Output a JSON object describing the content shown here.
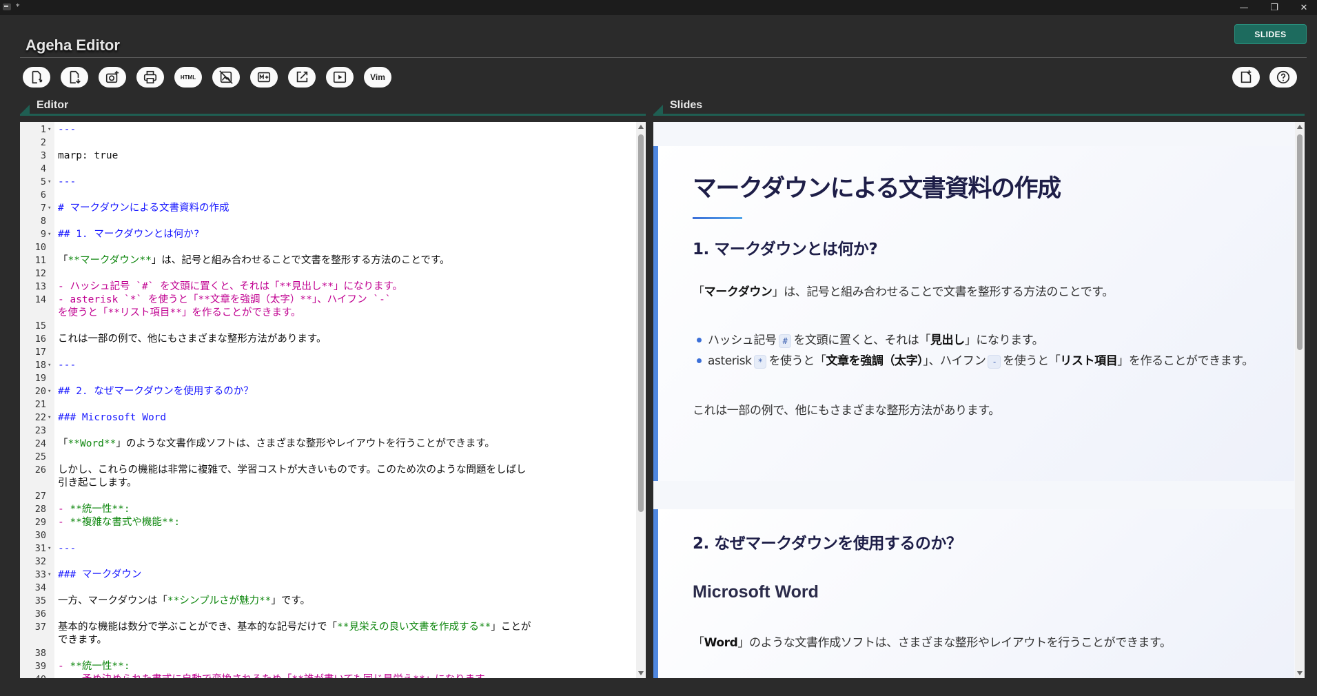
{
  "window": {
    "title_icon": "terminal-icon",
    "title_text": "*",
    "minimize": "—",
    "maximize": "❐",
    "close": "✕"
  },
  "header": {
    "app_title": "Ageha Editor",
    "mode_button": "SLIDES"
  },
  "toolbar": {
    "html_label": "HTML",
    "vim_label": "Vim",
    "left_icons": [
      "open-file-icon",
      "save-file-icon",
      "screenshot-icon",
      "print-icon",
      "html-export-icon",
      "hide-image-icon",
      "markdown-icon",
      "open-external-icon",
      "play-slideshow-icon",
      "vim-mode-icon"
    ],
    "right_icons": [
      "new-file-icon",
      "help-icon"
    ]
  },
  "panels": {
    "editor_label": "Editor",
    "slides_label": "Slides"
  },
  "editor": {
    "lines": [
      {
        "n": "1",
        "fold": true,
        "segs": [
          {
            "c": "blue",
            "t": "---"
          }
        ]
      },
      {
        "n": "2",
        "segs": []
      },
      {
        "n": "3",
        "segs": [
          {
            "c": "",
            "t": "marp: true"
          }
        ]
      },
      {
        "n": "4",
        "segs": []
      },
      {
        "n": "5",
        "fold": true,
        "segs": [
          {
            "c": "blue",
            "t": "---"
          }
        ]
      },
      {
        "n": "6",
        "segs": []
      },
      {
        "n": "7",
        "fold": true,
        "segs": [
          {
            "c": "blue",
            "t": "# マークダウンによる文書資料の作成"
          }
        ]
      },
      {
        "n": "8",
        "segs": []
      },
      {
        "n": "9",
        "fold": true,
        "segs": [
          {
            "c": "blue",
            "t": "## 1. マークダウンとは何か?"
          }
        ]
      },
      {
        "n": "10",
        "segs": []
      },
      {
        "n": "11",
        "segs": [
          {
            "c": "",
            "t": "「"
          },
          {
            "c": "green",
            "t": "**マークダウン**"
          },
          {
            "c": "",
            "t": "」は、記号と組み合わせることで文書を整形する方法のことです。"
          }
        ]
      },
      {
        "n": "12",
        "segs": []
      },
      {
        "n": "13",
        "segs": [
          {
            "c": "magenta",
            "t": "- ハッシュ記号 `#` を文頭に置くと、それは「**見出し**」になります。"
          }
        ]
      },
      {
        "n": "14",
        "segs": [
          {
            "c": "magenta",
            "t": "- asterisk `*` を使うと「**文章を強調（太字）**」、ハイフン `-`\nを使うと「**リスト項目**」を作ることができます。"
          }
        ]
      },
      {
        "n": "15",
        "segs": []
      },
      {
        "n": "16",
        "segs": [
          {
            "c": "",
            "t": "これは一部の例で、他にもさまざまな整形方法があります。"
          }
        ]
      },
      {
        "n": "17",
        "segs": []
      },
      {
        "n": "18",
        "fold": true,
        "segs": [
          {
            "c": "blue",
            "t": "---"
          }
        ]
      },
      {
        "n": "19",
        "segs": []
      },
      {
        "n": "20",
        "fold": true,
        "segs": [
          {
            "c": "blue",
            "t": "## 2. なぜマークダウンを使用するのか？"
          }
        ]
      },
      {
        "n": "21",
        "segs": []
      },
      {
        "n": "22",
        "fold": true,
        "segs": [
          {
            "c": "blue",
            "t": "### Microsoft Word"
          }
        ]
      },
      {
        "n": "23",
        "segs": []
      },
      {
        "n": "24",
        "segs": [
          {
            "c": "",
            "t": "「"
          },
          {
            "c": "green",
            "t": "**Word**"
          },
          {
            "c": "",
            "t": "」のような文書作成ソフトは、さまざまな整形やレイアウトを行うことができます。"
          }
        ]
      },
      {
        "n": "25",
        "segs": []
      },
      {
        "n": "26",
        "segs": [
          {
            "c": "",
            "t": "しかし、これらの機能は非常に複雑で、学習コストが大きいものです。このため次のような問題をしばし\n引き起こします。"
          }
        ]
      },
      {
        "n": "27",
        "segs": []
      },
      {
        "n": "28",
        "segs": [
          {
            "c": "magenta",
            "t": "- "
          },
          {
            "c": "green",
            "t": "**統一性**:"
          }
        ]
      },
      {
        "n": "29",
        "segs": [
          {
            "c": "magenta",
            "t": "- "
          },
          {
            "c": "green",
            "t": "**複雑な書式や機能**:"
          }
        ]
      },
      {
        "n": "30",
        "segs": []
      },
      {
        "n": "31",
        "fold": true,
        "segs": [
          {
            "c": "blue",
            "t": "---"
          }
        ]
      },
      {
        "n": "32",
        "segs": []
      },
      {
        "n": "33",
        "fold": true,
        "segs": [
          {
            "c": "blue",
            "t": "### マークダウン"
          }
        ]
      },
      {
        "n": "34",
        "segs": []
      },
      {
        "n": "35",
        "segs": [
          {
            "c": "",
            "t": "一方、マークダウンは「"
          },
          {
            "c": "green",
            "t": "**シンプルさが魅力**"
          },
          {
            "c": "",
            "t": "」です。"
          }
        ]
      },
      {
        "n": "36",
        "segs": []
      },
      {
        "n": "37",
        "segs": [
          {
            "c": "",
            "t": "基本的な機能は数分で学ぶことができ、基本的な記号だけで「"
          },
          {
            "c": "green",
            "t": "**見栄えの良い文書を作成する**"
          },
          {
            "c": "",
            "t": "」ことが\nできます。"
          }
        ]
      },
      {
        "n": "38",
        "segs": []
      },
      {
        "n": "39",
        "segs": [
          {
            "c": "magenta",
            "t": "- "
          },
          {
            "c": "green",
            "t": "**統一性**:"
          }
        ]
      },
      {
        "n": "40",
        "segs": [
          {
            "c": "magenta",
            "t": "    予め決められた書式に自動で変換されるため「**誰が書いても同じ見栄え**」になります。"
          }
        ]
      }
    ]
  },
  "slides": {
    "s1": {
      "h1": "マークダウンによる文書資料の作成",
      "h2": "1. マークダウンとは何か?",
      "p1_pre": "「",
      "p1_bold": "マークダウン",
      "p1_post": "」は、記号と組み合わせることで文書を整形する方法のことです。",
      "b1_pre": "ハッシュ記号",
      "b1_code": "#",
      "b1_mid": "を文頭に置くと、それは「",
      "b1_bold": "見出し",
      "b1_post": "」になります。",
      "b2_pre": "asterisk",
      "b2_code": "*",
      "b2_mid1": "を使うと「",
      "b2_bold1": "文章を強調（太字）",
      "b2_mid2": "」、ハイフン",
      "b2_code2": "-",
      "b2_mid3": "を使うと「",
      "b2_bold2": "リスト項目",
      "b2_post": "」を作ることができます。",
      "p2": "これは一部の例で、他にもさまざまな整形方法があります。"
    },
    "s2": {
      "h2": "2. なぜマークダウンを使用するのか？",
      "h3": "Microsoft Word",
      "p_pre": "「",
      "p_bold": "Word",
      "p_post": "」のような文書作成ソフトは、さまざまな整形やレイアウトを行うことができます。"
    }
  }
}
